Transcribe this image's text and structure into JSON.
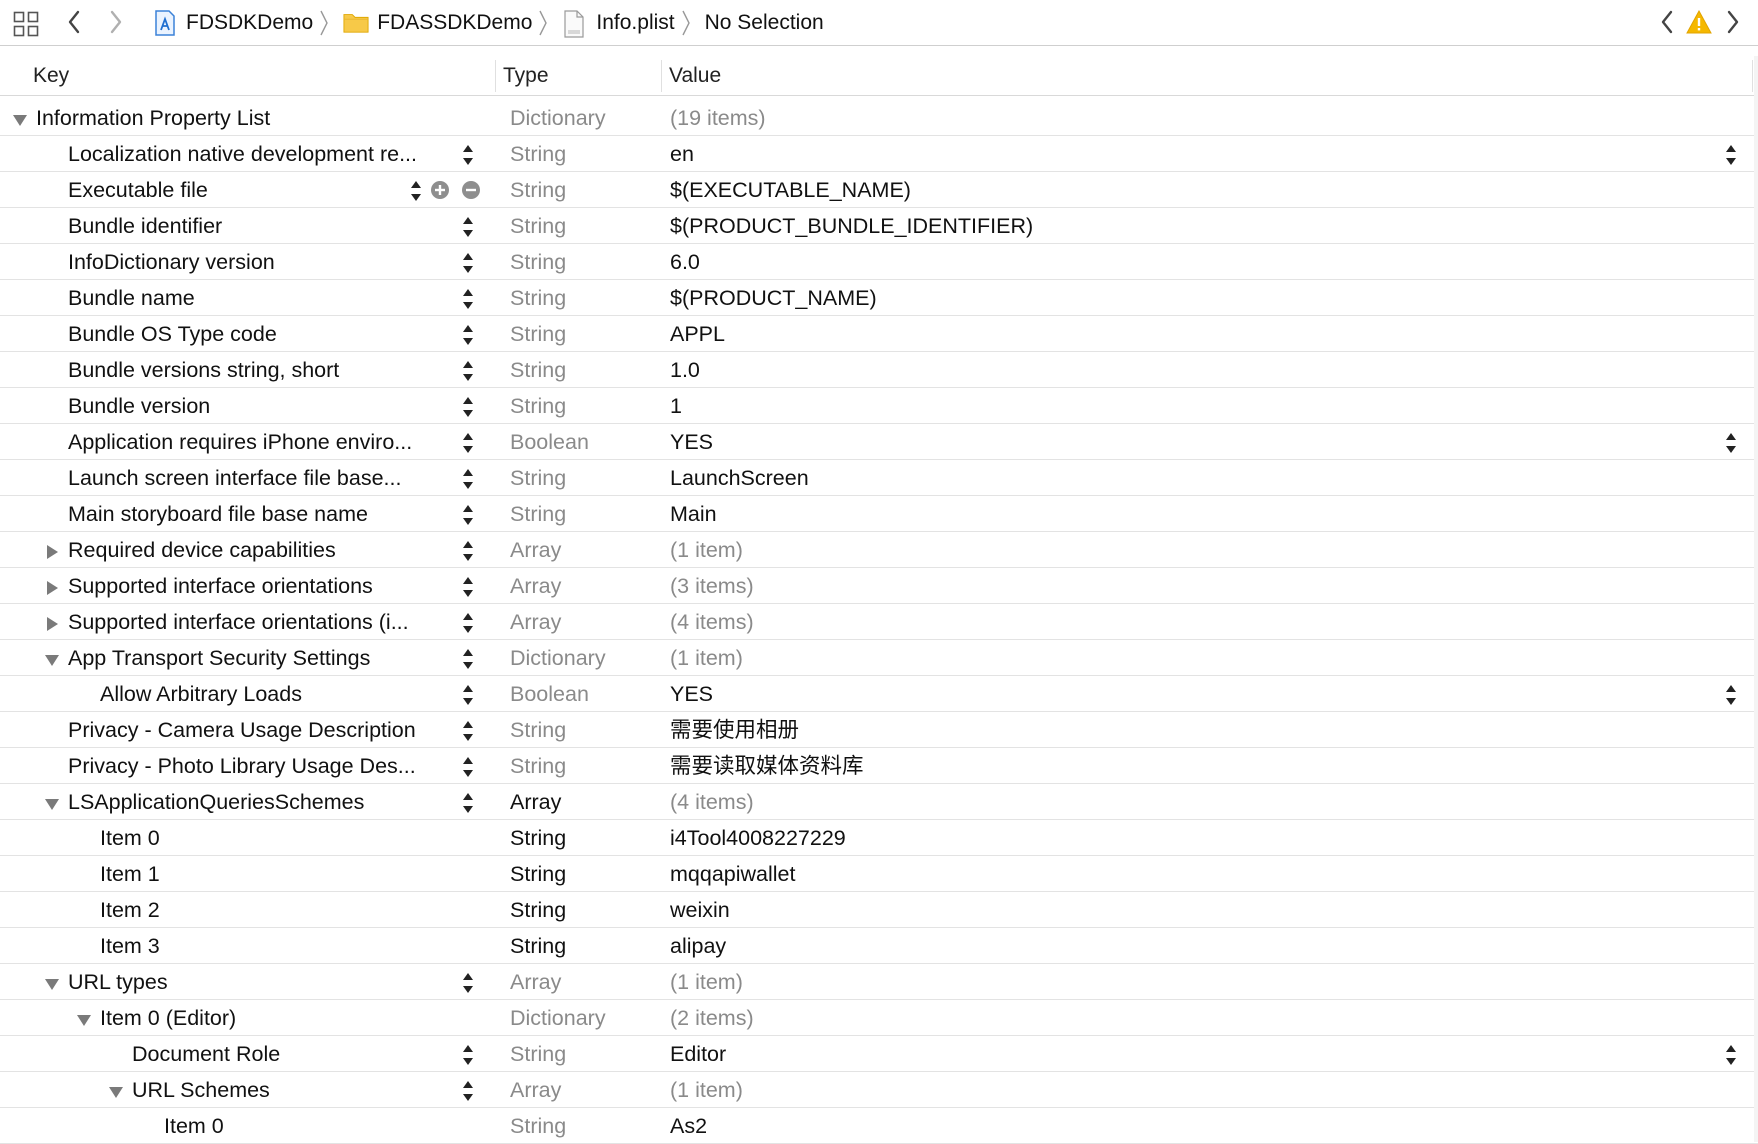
{
  "toolbar": {
    "grid_icon": "related-items-grid-icon",
    "back_icon": "chevron-left-icon",
    "forward_icon": "chevron-right-icon",
    "breadcrumbs": [
      {
        "label": "FDSDKDemo",
        "icon": "xcode-project-icon"
      },
      {
        "label": "FDASSDKDemo",
        "icon": "folder-icon"
      },
      {
        "label": "Info.plist",
        "icon": "plist-file-icon"
      },
      {
        "label": "No Selection",
        "icon": ""
      }
    ],
    "issue_prev_icon": "chevron-left-icon",
    "warning_icon": "warning-triangle-icon",
    "issue_next_icon": "chevron-right-icon",
    "warning_color": "#f5b800"
  },
  "columns": {
    "key": "Key",
    "type": "Type",
    "value": "Value"
  },
  "rows": [
    {
      "key": "Information Property List",
      "type": "Dictionary",
      "value": "(19 items)",
      "level": 0,
      "disclosure": "open",
      "stepper": false,
      "value_stepper": false,
      "muted_value": true,
      "strong_type": false
    },
    {
      "key": "Localization native development re...",
      "type": "String",
      "value": "en",
      "level": 1,
      "disclosure": "none",
      "stepper": true,
      "value_stepper": true,
      "muted_value": false,
      "strong_type": false
    },
    {
      "key": "Executable file",
      "type": "String",
      "value": "$(EXECUTABLE_NAME)",
      "level": 1,
      "disclosure": "none",
      "stepper": true,
      "value_stepper": false,
      "muted_value": false,
      "strong_type": false,
      "row_controls": true
    },
    {
      "key": "Bundle identifier",
      "type": "String",
      "value": "$(PRODUCT_BUNDLE_IDENTIFIER)",
      "level": 1,
      "disclosure": "none",
      "stepper": true,
      "value_stepper": false,
      "muted_value": false,
      "strong_type": false
    },
    {
      "key": "InfoDictionary version",
      "type": "String",
      "value": "6.0",
      "level": 1,
      "disclosure": "none",
      "stepper": true,
      "value_stepper": false,
      "muted_value": false,
      "strong_type": false
    },
    {
      "key": "Bundle name",
      "type": "String",
      "value": "$(PRODUCT_NAME)",
      "level": 1,
      "disclosure": "none",
      "stepper": true,
      "value_stepper": false,
      "muted_value": false,
      "strong_type": false
    },
    {
      "key": "Bundle OS Type code",
      "type": "String",
      "value": "APPL",
      "level": 1,
      "disclosure": "none",
      "stepper": true,
      "value_stepper": false,
      "muted_value": false,
      "strong_type": false
    },
    {
      "key": "Bundle versions string, short",
      "type": "String",
      "value": "1.0",
      "level": 1,
      "disclosure": "none",
      "stepper": true,
      "value_stepper": false,
      "muted_value": false,
      "strong_type": false
    },
    {
      "key": "Bundle version",
      "type": "String",
      "value": "1",
      "level": 1,
      "disclosure": "none",
      "stepper": true,
      "value_stepper": false,
      "muted_value": false,
      "strong_type": false
    },
    {
      "key": "Application requires iPhone enviro...",
      "type": "Boolean",
      "value": "YES",
      "level": 1,
      "disclosure": "none",
      "stepper": true,
      "value_stepper": true,
      "muted_value": false,
      "strong_type": false
    },
    {
      "key": "Launch screen interface file base...",
      "type": "String",
      "value": "LaunchScreen",
      "level": 1,
      "disclosure": "none",
      "stepper": true,
      "value_stepper": false,
      "muted_value": false,
      "strong_type": false
    },
    {
      "key": "Main storyboard file base name",
      "type": "String",
      "value": "Main",
      "level": 1,
      "disclosure": "none",
      "stepper": true,
      "value_stepper": false,
      "muted_value": false,
      "strong_type": false
    },
    {
      "key": "Required device capabilities",
      "type": "Array",
      "value": "(1 item)",
      "level": 1,
      "disclosure": "closed",
      "stepper": true,
      "value_stepper": false,
      "muted_value": true,
      "strong_type": false
    },
    {
      "key": "Supported interface orientations",
      "type": "Array",
      "value": "(3 items)",
      "level": 1,
      "disclosure": "closed",
      "stepper": true,
      "value_stepper": false,
      "muted_value": true,
      "strong_type": false
    },
    {
      "key": "Supported interface orientations (i...",
      "type": "Array",
      "value": "(4 items)",
      "level": 1,
      "disclosure": "closed",
      "stepper": true,
      "value_stepper": false,
      "muted_value": true,
      "strong_type": false
    },
    {
      "key": "App Transport Security Settings",
      "type": "Dictionary",
      "value": "(1 item)",
      "level": 1,
      "disclosure": "open",
      "stepper": true,
      "value_stepper": false,
      "muted_value": true,
      "strong_type": false
    },
    {
      "key": "Allow Arbitrary Loads",
      "type": "Boolean",
      "value": "YES",
      "level": 2,
      "disclosure": "none",
      "stepper": true,
      "value_stepper": true,
      "muted_value": false,
      "strong_type": false
    },
    {
      "key": "Privacy - Camera Usage Description",
      "type": "String",
      "value": "需要使用相册",
      "level": 1,
      "disclosure": "none",
      "stepper": true,
      "value_stepper": false,
      "muted_value": false,
      "strong_type": false
    },
    {
      "key": "Privacy - Photo Library Usage Des...",
      "type": "String",
      "value": "需要读取媒体资料库",
      "level": 1,
      "disclosure": "none",
      "stepper": true,
      "value_stepper": false,
      "muted_value": false,
      "strong_type": false
    },
    {
      "key": "LSApplicationQueriesSchemes",
      "type": "Array",
      "value": "(4 items)",
      "level": 1,
      "disclosure": "open",
      "stepper": true,
      "value_stepper": false,
      "muted_value": true,
      "strong_type": true
    },
    {
      "key": "Item 0",
      "type": "String",
      "value": "i4Tool4008227229",
      "level": 2,
      "disclosure": "none",
      "stepper": false,
      "value_stepper": false,
      "muted_value": false,
      "strong_type": true
    },
    {
      "key": "Item 1",
      "type": "String",
      "value": "mqqapiwallet",
      "level": 2,
      "disclosure": "none",
      "stepper": false,
      "value_stepper": false,
      "muted_value": false,
      "strong_type": true
    },
    {
      "key": "Item 2",
      "type": "String",
      "value": "weixin",
      "level": 2,
      "disclosure": "none",
      "stepper": false,
      "value_stepper": false,
      "muted_value": false,
      "strong_type": true
    },
    {
      "key": "Item 3",
      "type": "String",
      "value": "alipay",
      "level": 2,
      "disclosure": "none",
      "stepper": false,
      "value_stepper": false,
      "muted_value": false,
      "strong_type": true
    },
    {
      "key": "URL types",
      "type": "Array",
      "value": "(1 item)",
      "level": 1,
      "disclosure": "open",
      "stepper": true,
      "value_stepper": false,
      "muted_value": true,
      "strong_type": false
    },
    {
      "key": "Item 0 (Editor)",
      "type": "Dictionary",
      "value": "(2 items)",
      "level": 2,
      "disclosure": "open",
      "stepper": false,
      "value_stepper": false,
      "muted_value": true,
      "strong_type": false
    },
    {
      "key": "Document Role",
      "type": "String",
      "value": "Editor",
      "level": 3,
      "disclosure": "none",
      "stepper": true,
      "value_stepper": true,
      "muted_value": false,
      "strong_type": false
    },
    {
      "key": "URL Schemes",
      "type": "Array",
      "value": "(1 item)",
      "level": 3,
      "disclosure": "open",
      "stepper": true,
      "value_stepper": false,
      "muted_value": true,
      "strong_type": false
    },
    {
      "key": "Item 0",
      "type": "String",
      "value": "As2",
      "level": 4,
      "disclosure": "none",
      "stepper": false,
      "value_stepper": false,
      "muted_value": false,
      "strong_type": false
    }
  ]
}
